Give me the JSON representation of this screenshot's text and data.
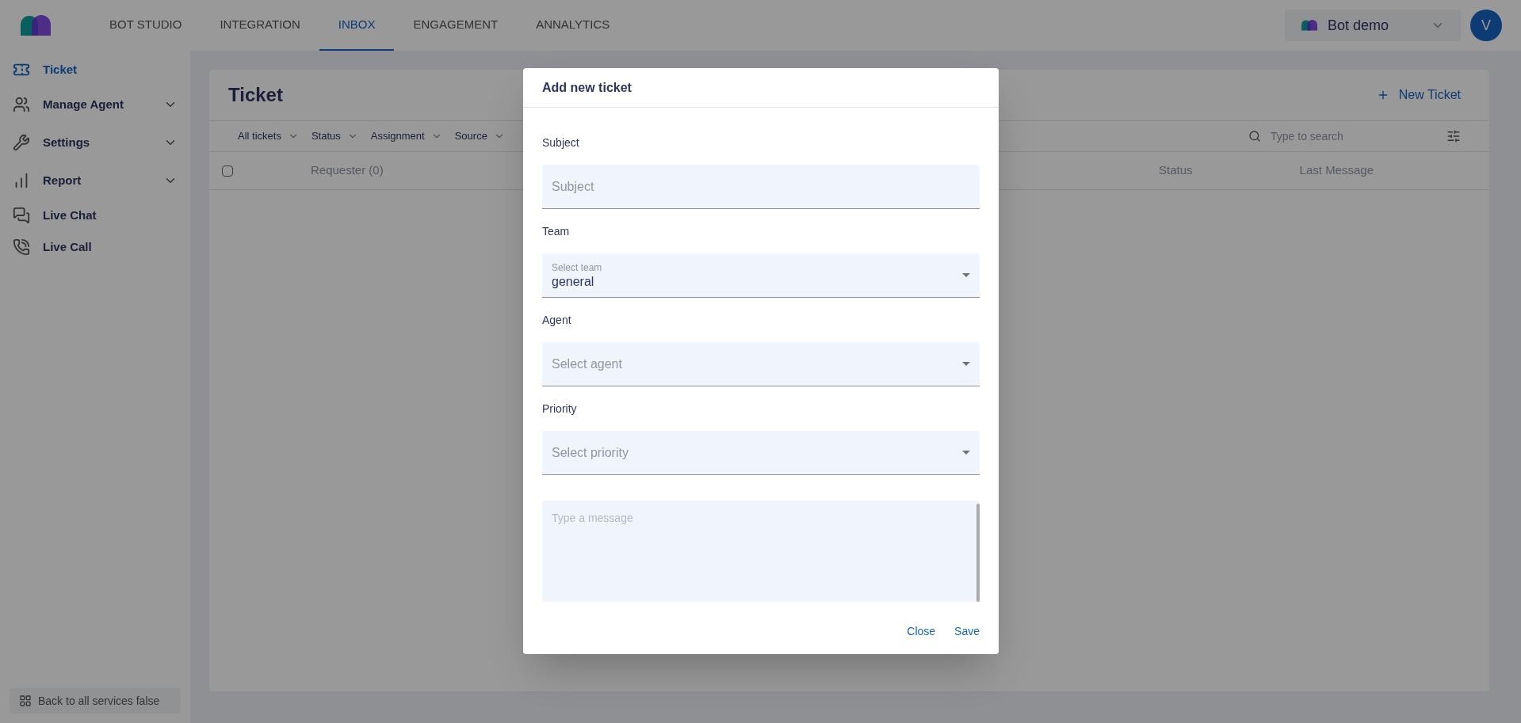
{
  "nav_tabs": [
    {
      "label": "BOT STUDIO",
      "selected": false
    },
    {
      "label": "INTEGRATION",
      "selected": false
    },
    {
      "label": "INBOX",
      "selected": true
    },
    {
      "label": "ENGAGEMENT",
      "selected": false
    },
    {
      "label": "ANNALYTICS",
      "selected": false
    }
  ],
  "workspace": {
    "name": "Bot demo"
  },
  "avatar": {
    "initial": "V"
  },
  "sidebar": {
    "items": [
      {
        "label": "Ticket",
        "kind": "link",
        "selected": true
      },
      {
        "label": "Manage Agent",
        "kind": "group",
        "selected": false
      },
      {
        "label": "Settings",
        "kind": "group",
        "selected": false
      },
      {
        "label": "Report",
        "kind": "group",
        "selected": false
      },
      {
        "label": "Live Chat",
        "kind": "link",
        "selected": false
      },
      {
        "label": "Live Call",
        "kind": "link",
        "selected": false
      }
    ],
    "back_button": "Back to all services false"
  },
  "page": {
    "title": "Ticket",
    "new_button": "New Ticket",
    "filters": [
      "All tickets",
      "Status",
      "Assignment",
      "Source"
    ],
    "search": {
      "placeholder": "Type to search"
    },
    "table": {
      "select_all": {
        "checked": false
      },
      "columns": [
        {
          "label": "Requester (0)"
        },
        {
          "label": "Status"
        },
        {
          "label": "Last Message"
        }
      ]
    }
  },
  "dialog": {
    "title": "Add new ticket",
    "fields": [
      {
        "label": "Subject",
        "kind": "text",
        "placeholder": "Subject"
      },
      {
        "label": "Team",
        "kind": "select",
        "floating_label": "Select team",
        "value": "general"
      },
      {
        "label": "Agent",
        "kind": "select",
        "placeholder": "Select agent"
      },
      {
        "label": "Priority",
        "kind": "select",
        "placeholder": "Select priority"
      }
    ],
    "message": {
      "placeholder": "Type a message"
    },
    "buttons": [
      "Close",
      "Save"
    ]
  }
}
